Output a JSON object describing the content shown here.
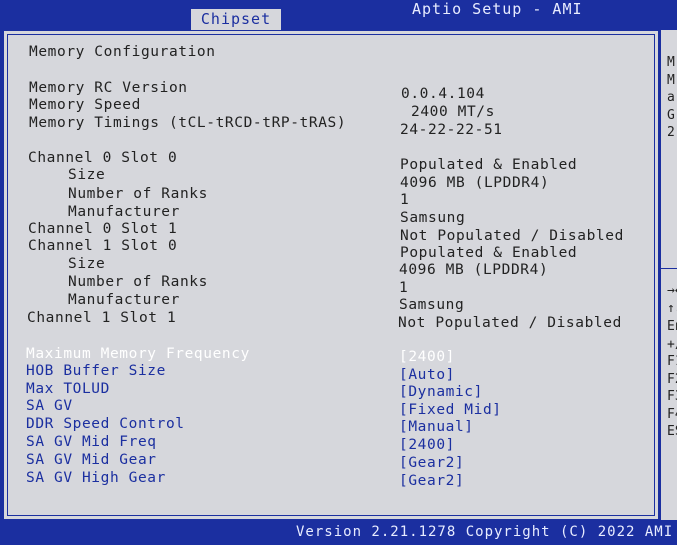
{
  "header": {
    "title": "Aptio Setup - AMI",
    "active_tab": "Chipset"
  },
  "page": {
    "heading": "Memory Configuration",
    "info": [
      {
        "label": "Memory RC Version",
        "value": "0.0.4.104"
      },
      {
        "label": "Memory Speed",
        "value": "2400 MT/s"
      },
      {
        "label": "Memory Timings (tCL-tRCD-tRP-tRAS)",
        "value": "24-22-22-51"
      }
    ],
    "channels": [
      {
        "label": "Channel 0 Slot 0",
        "value": "Populated & Enabled"
      },
      {
        "label": "Size",
        "value": "4096 MB (LPDDR4)"
      },
      {
        "label": "Number of Ranks",
        "value": "1"
      },
      {
        "label": "Manufacturer",
        "value": "Samsung"
      },
      {
        "label": "Channel 0 Slot 1",
        "value": "Not Populated / Disabled"
      },
      {
        "label": "Channel 1 Slot 0",
        "value": "Populated & Enabled"
      },
      {
        "label": "Size",
        "value": "4096 MB (LPDDR4)"
      },
      {
        "label": "Number of Ranks",
        "value": "1"
      },
      {
        "label": "Manufacturer",
        "value": "Samsung"
      },
      {
        "label": "Channel 1 Slot 1",
        "value": "Not Populated / Disabled"
      }
    ],
    "options": [
      {
        "label": "Maximum Memory Frequency",
        "value": "[2400]"
      },
      {
        "label": "HOB Buffer Size",
        "value": "[Auto]"
      },
      {
        "label": "Max TOLUD",
        "value": "[Dynamic]"
      },
      {
        "label": "SA GV",
        "value": "[Fixed Mid]"
      },
      {
        "label": "DDR Speed Control",
        "value": "[Manual]"
      },
      {
        "label": "SA GV Mid Freq",
        "value": "[2400]"
      },
      {
        "label": "SA GV Mid Gear",
        "value": "[Gear2]"
      },
      {
        "label": "SA GV High Gear",
        "value": "[Gear2]"
      }
    ]
  },
  "help_panel": {
    "top_chars": [
      "M",
      "M",
      "a",
      "G",
      "2"
    ],
    "bottom_chars": [
      "→←",
      "↑↓",
      "En",
      "+/",
      "F1",
      "F2",
      "F3",
      "F4",
      "ES"
    ]
  },
  "footer": {
    "version": "Version 2.21.1278 Copyright (C) 2022 AMI"
  },
  "colors": {
    "background": "#1b2fa0",
    "panel": "#d6d7dc",
    "selected_text": "#ffffff",
    "option_text": "#1b2fa0"
  }
}
